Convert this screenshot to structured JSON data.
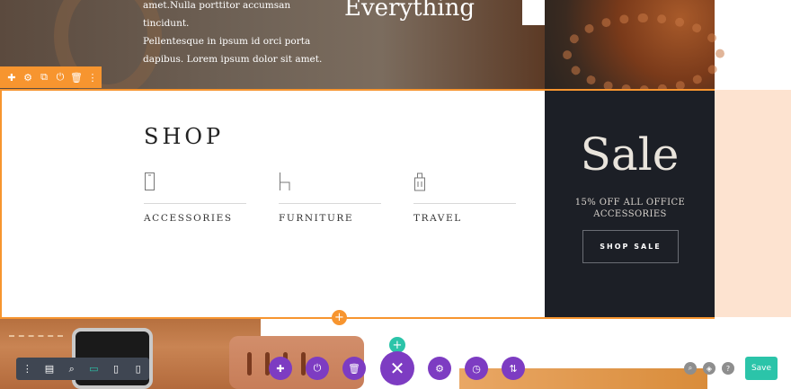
{
  "hero": {
    "text_lines": [
      "amet.Nulla porttitor accumsan tincidunt.",
      "Pellentesque in ipsum id orci porta",
      "dapibus. Lorem ipsum dolor sit amet."
    ],
    "heading": "Everything"
  },
  "module_toolbar": {
    "icons": [
      "plus-icon",
      "gear-icon",
      "duplicate-icon",
      "power-icon",
      "trash-icon",
      "more-icon"
    ]
  },
  "shop": {
    "title": "SHOP",
    "categories": [
      {
        "label": "ACCESSORIES",
        "icon": "phone-icon"
      },
      {
        "label": "FURNITURE",
        "icon": "chair-icon"
      },
      {
        "label": "TRAVEL",
        "icon": "luggage-icon"
      }
    ]
  },
  "sale": {
    "title": "Sale",
    "subtitle": "15% OFF ALL OFFICE ACCESSORIES",
    "button": "SHOP SALE"
  },
  "builder": {
    "view_icons": [
      "more-icon",
      "layout-icon",
      "zoom-icon",
      "desktop-icon",
      "tablet-icon",
      "phone-icon"
    ],
    "active_view": "desktop-icon",
    "actions": [
      "add-icon",
      "power-icon",
      "trash-icon",
      "close-icon",
      "gear-icon",
      "history-icon",
      "sort-icon"
    ],
    "right_icons": [
      "search-icon",
      "layers-icon",
      "help-icon"
    ],
    "save_label": "Save"
  },
  "colors": {
    "accent_orange": "#f7952f",
    "builder_purple": "#7d3cc2",
    "builder_teal": "#2bc4a9",
    "sale_bg": "#1c1f26",
    "peach": "#fde3d0"
  }
}
